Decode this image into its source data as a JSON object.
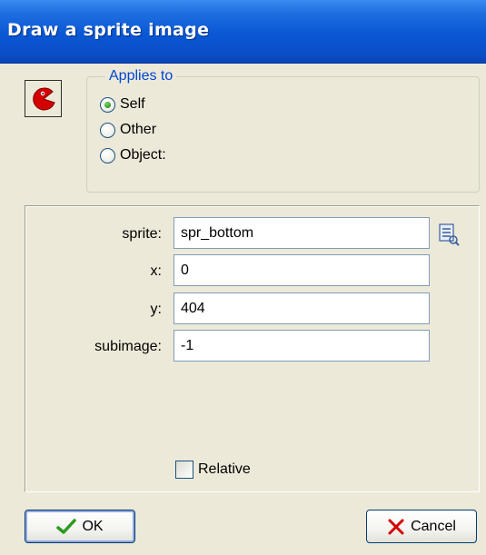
{
  "window": {
    "title": "Draw a sprite image",
    "titlebar_color": "#0a57d6"
  },
  "action_icon": {
    "name": "pacman-sprite-icon",
    "color": "#d40000"
  },
  "applies_to": {
    "legend": "Applies to",
    "options": [
      {
        "label": "Self",
        "checked": true
      },
      {
        "label": "Other",
        "checked": false
      },
      {
        "label": "Object:",
        "checked": false
      }
    ]
  },
  "fields": {
    "sprite": {
      "label": "sprite:",
      "value": "spr_bottom"
    },
    "x": {
      "label": "x:",
      "value": "0"
    },
    "y": {
      "label": "y:",
      "value": "404"
    },
    "subimage": {
      "label": "subimage:",
      "value": "-1"
    }
  },
  "relative": {
    "label": "Relative",
    "checked": false
  },
  "buttons": {
    "ok": {
      "label": "OK",
      "icon": "checkmark-icon",
      "color": "#2b9a1f"
    },
    "cancel": {
      "label": "Cancel",
      "icon": "x-icon",
      "color": "#d40000"
    }
  }
}
